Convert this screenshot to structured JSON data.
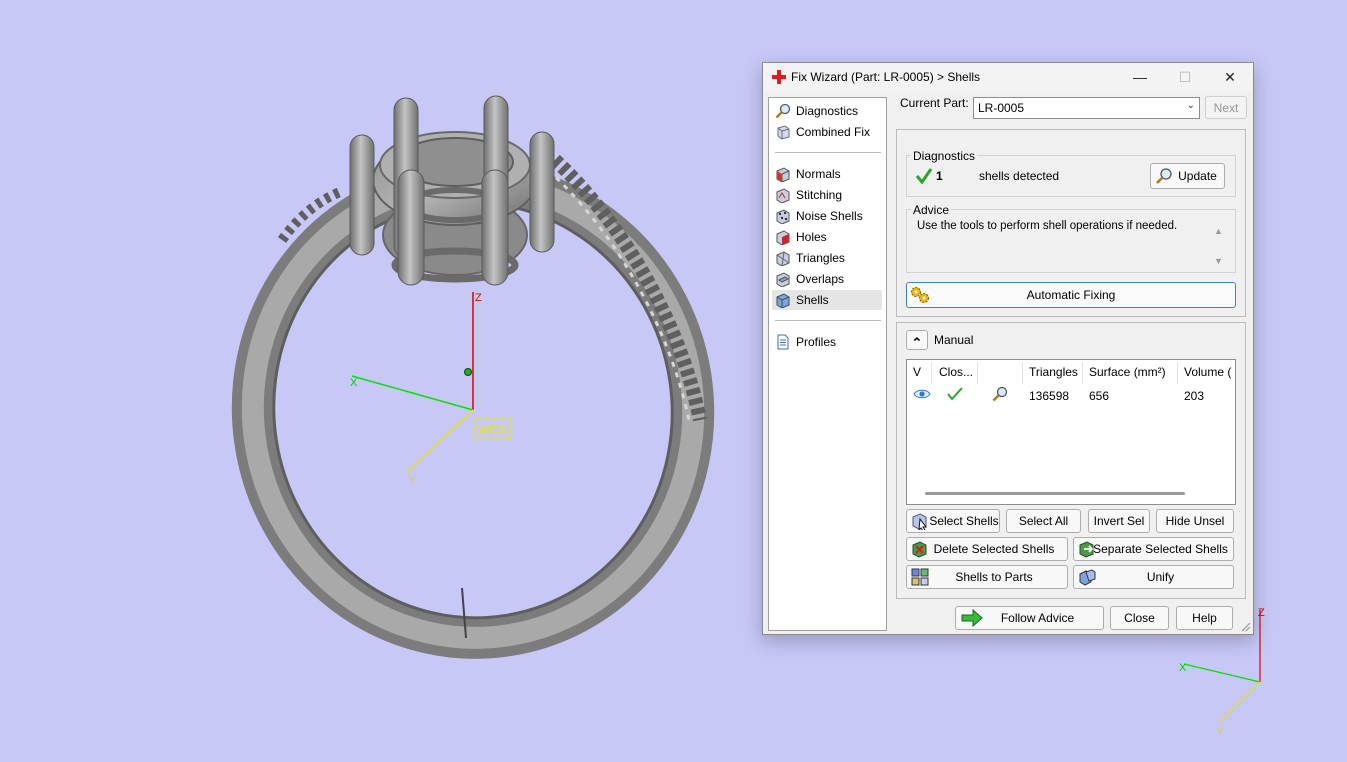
{
  "viewport": {
    "wcs_label": "WCS",
    "axis_x": "X",
    "axis_y": "Y",
    "axis_z": "Z",
    "mini_axis_x": "X",
    "mini_axis_y": "Y",
    "mini_axis_z": "Z"
  },
  "window": {
    "title": "Fix Wizard (Part: LR-0005) > Shells",
    "minimize": "—",
    "maximize": "☐",
    "close": "✕"
  },
  "nav": {
    "top": [
      "Diagnostics",
      "Combined Fix"
    ],
    "tools": [
      "Normals",
      "Stitching",
      "Noise Shells",
      "Holes",
      "Triangles",
      "Overlaps",
      "Shells"
    ],
    "active": "Shells",
    "bottom": [
      "Profiles"
    ]
  },
  "current_part": {
    "label": "Current Part:",
    "value": "LR-0005",
    "next_button": "Next"
  },
  "diagnostics": {
    "title": "Diagnostics",
    "count": "1",
    "text": "shells detected",
    "update_button": "Update"
  },
  "advice": {
    "title": "Advice",
    "text": "Use the tools to perform shell operations if needed."
  },
  "automatic_fixing": "Automatic Fixing",
  "manual": {
    "label": "Manual",
    "collapse_glyph": "⌃"
  },
  "table": {
    "columns": [
      "V",
      "Clos...",
      "",
      "Triangles",
      "Surface (mm²)",
      "Volume ("
    ],
    "rows": [
      {
        "triangles": "136598",
        "surface": "656",
        "volume": "203"
      }
    ]
  },
  "buttons": {
    "select_shells": "Select Shells",
    "select_all": "Select All",
    "invert_sel": "Invert Sel",
    "hide_unsel": "Hide Unsel",
    "delete_selected": "Delete Selected Shells",
    "separate_selected": "Separate Selected Shells",
    "shells_to_parts": "Shells to Parts",
    "unify": "Unify",
    "follow_advice": "Follow Advice",
    "close": "Close",
    "help": "Help"
  },
  "colors": {
    "background": "#c8c8f8",
    "axis_x": "#00e000",
    "axis_y": "#e6e600",
    "axis_z": "#e00000",
    "ok_green": "#2aa52a",
    "accent_blue": "#3c7fd6"
  }
}
